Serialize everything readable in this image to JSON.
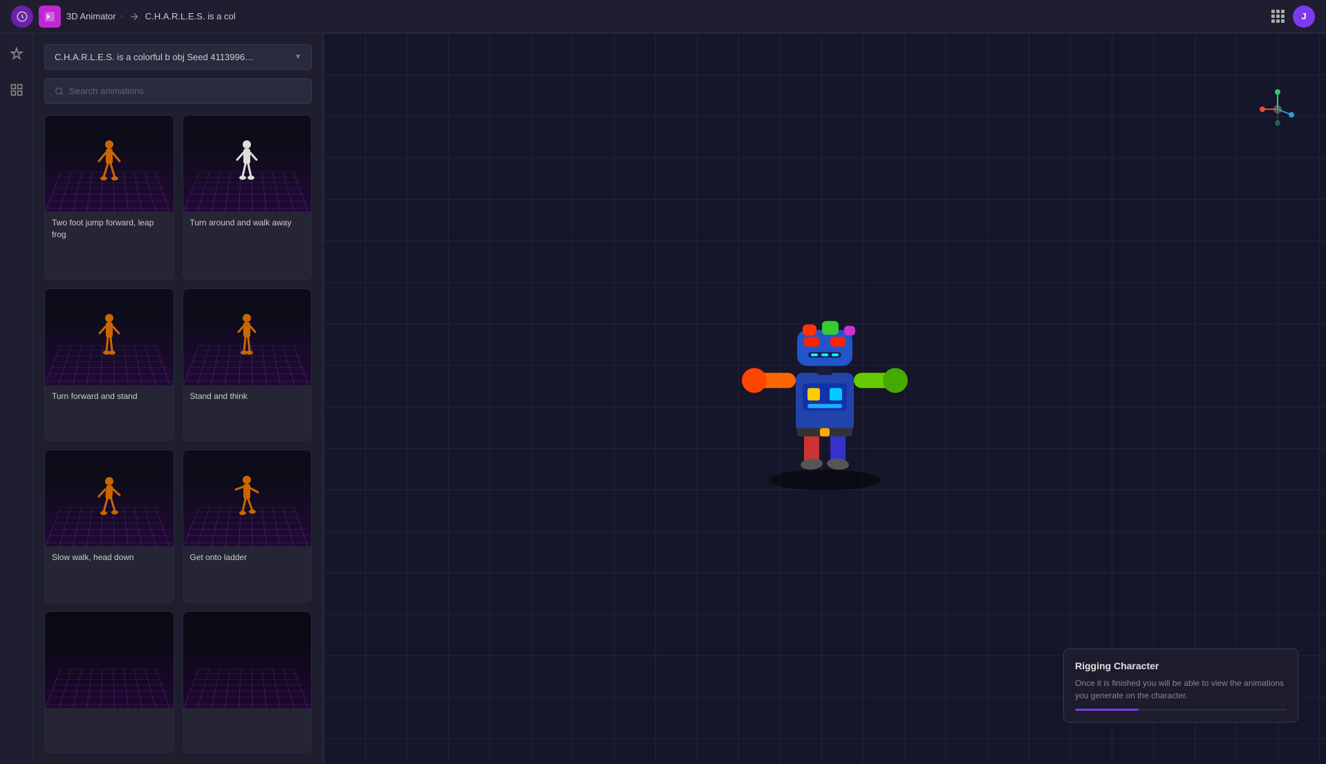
{
  "topnav": {
    "brand_label": "3D Animator",
    "breadcrumb_sep": "›",
    "project_name": "C.H.A.R.L.E.S. is a col",
    "user_initial": "J"
  },
  "left_panel": {
    "dropdown_label": "C.H.A.R.L.E.S. is a colorful b obj Seed 4113996…",
    "search_placeholder": "Search animations",
    "animations": [
      {
        "id": 1,
        "label": "Two foot jump forward, leap frog"
      },
      {
        "id": 2,
        "label": "Turn around and walk away"
      },
      {
        "id": 3,
        "label": "Turn forward and stand"
      },
      {
        "id": 4,
        "label": "Stand and think"
      },
      {
        "id": 5,
        "label": "Slow walk, head down"
      },
      {
        "id": 6,
        "label": "Get onto ladder"
      },
      {
        "id": 7,
        "label": ""
      },
      {
        "id": 8,
        "label": ""
      }
    ]
  },
  "rigging": {
    "title": "Rigging Character",
    "description": "Once it is finished you will be able to view the animations you generate on the character."
  },
  "gizmo": {
    "colors": {
      "x": "#e74c3c",
      "y": "#2ecc71",
      "z": "#3498db"
    }
  }
}
